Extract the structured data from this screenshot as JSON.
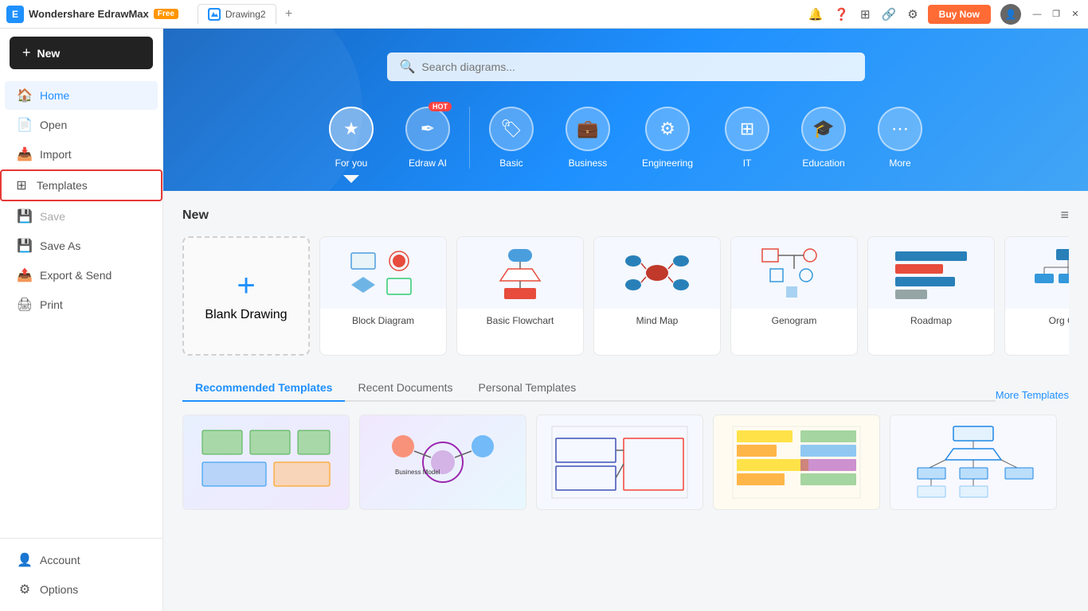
{
  "app": {
    "name": "Wondershare EdrawMax",
    "badge": "Free",
    "buy_now": "Buy Now"
  },
  "tabs": [
    {
      "label": "Drawing2",
      "active": true
    }
  ],
  "window_controls": {
    "minimize": "—",
    "maximize": "❐",
    "close": "✕"
  },
  "sidebar": {
    "new_button": "New",
    "items": [
      {
        "id": "home",
        "label": "Home",
        "icon": "🏠",
        "active": true
      },
      {
        "id": "open",
        "label": "Open",
        "icon": "📄"
      },
      {
        "id": "import",
        "label": "Import",
        "icon": "📥"
      },
      {
        "id": "templates",
        "label": "Templates",
        "icon": "⊞",
        "highlighted": true
      },
      {
        "id": "save",
        "label": "Save",
        "icon": "💾",
        "disabled": true
      },
      {
        "id": "save-as",
        "label": "Save As",
        "icon": "💾"
      },
      {
        "id": "export",
        "label": "Export & Send",
        "icon": "🖨"
      },
      {
        "id": "print",
        "label": "Print",
        "icon": "🖨"
      }
    ],
    "bottom_items": [
      {
        "id": "account",
        "label": "Account",
        "icon": "👤"
      },
      {
        "id": "options",
        "label": "Options",
        "icon": "⚙"
      }
    ]
  },
  "hero": {
    "search_placeholder": "Search diagrams...",
    "categories": [
      {
        "id": "for-you",
        "label": "For you",
        "icon": "✦",
        "active": true
      },
      {
        "id": "edraw-ai",
        "label": "Edraw AI",
        "icon": "✒",
        "hot": true
      },
      {
        "id": "basic",
        "label": "Basic",
        "icon": "🏷"
      },
      {
        "id": "business",
        "label": "Business",
        "icon": "💼"
      },
      {
        "id": "engineering",
        "label": "Engineering",
        "icon": "⚙"
      },
      {
        "id": "it",
        "label": "IT",
        "icon": "⊞"
      },
      {
        "id": "education",
        "label": "Education",
        "icon": "🎓"
      },
      {
        "id": "more",
        "label": "More",
        "icon": "⋯"
      }
    ]
  },
  "new_section": {
    "title": "New",
    "blank_drawing": "Blank Drawing",
    "templates": [
      {
        "label": "Block Diagram"
      },
      {
        "label": "Basic Flowchart"
      },
      {
        "label": "Mind Map"
      },
      {
        "label": "Genogram"
      },
      {
        "label": "Roadmap"
      },
      {
        "label": "Org Ch..."
      }
    ]
  },
  "template_section": {
    "tabs": [
      {
        "label": "Recommended Templates",
        "active": true
      },
      {
        "label": "Recent Documents"
      },
      {
        "label": "Personal Templates"
      }
    ],
    "more_templates": "More Templates"
  }
}
